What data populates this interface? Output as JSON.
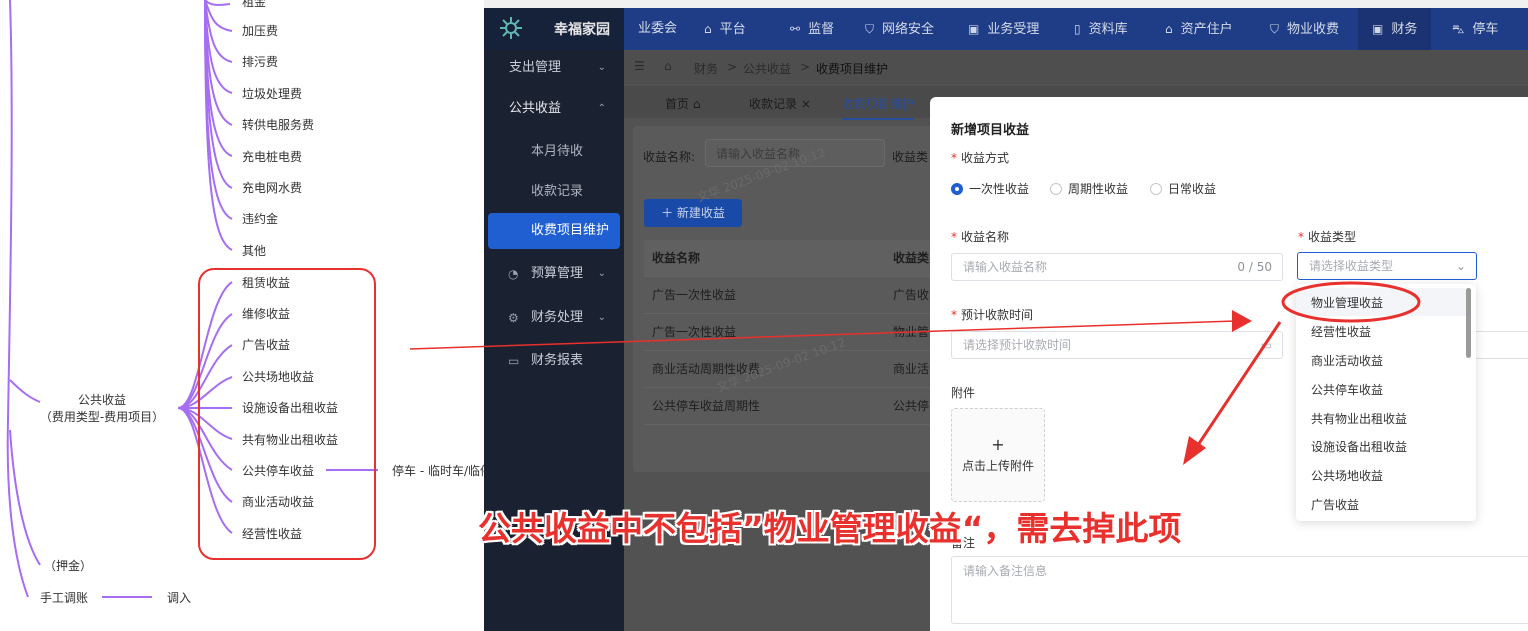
{
  "mindmap": {
    "top_items": [
      "租金",
      "加压费",
      "排污费",
      "垃圾处理费",
      "转供电服务费",
      "充电桩电费",
      "充电网水费",
      "违约金",
      "其他"
    ],
    "center_line1": "公共收益",
    "center_line2": "（费用类型-费用项目）",
    "boxed_items": [
      "租赁收益",
      "维修收益",
      "广告收益",
      "公共场地收益",
      "设施设备出租收益",
      "共有物业出租收益",
      "公共停车收益",
      "商业活动收益",
      "经营性收益"
    ],
    "parking_child": "停车 - 临时车/临停",
    "deposit": "（押金）",
    "manual_adjust": "手工调账",
    "transfer_in": "调入"
  },
  "app": {
    "logo_text": "幸福家园",
    "nav": [
      {
        "label": "业委会",
        "icon": ""
      },
      {
        "label": "平台",
        "icon": "⌂"
      },
      {
        "label": "监督",
        "icon": "⚯"
      },
      {
        "label": "网络安全",
        "icon": "⛉"
      },
      {
        "label": "业务受理",
        "icon": "▣"
      },
      {
        "label": "资料库",
        "icon": "▯"
      },
      {
        "label": "资产住户",
        "icon": "⌂"
      },
      {
        "label": "物业收费",
        "icon": "⛉"
      },
      {
        "label": "财务",
        "icon": "▣"
      },
      {
        "label": "停车",
        "icon": "⛍"
      }
    ],
    "sidebar": {
      "expense": "支出管理",
      "public_income": "公共收益",
      "this_month": "本月待收",
      "records": "收款记录",
      "item_maint": "收费项目维护",
      "budget": "预算管理",
      "finance_proc": "财务处理",
      "finance_report": "财务报表"
    },
    "breadcrumb": {
      "a": "财务",
      "b": "公共收益",
      "c": "收费项目维护",
      "sep": ">"
    },
    "tabs": {
      "home": "首页",
      "records": "收款记录",
      "maint": "收费项目维护"
    },
    "filter": {
      "name_label": "收益名称:",
      "name_placeholder": "请输入收益名称",
      "type_label": "收益类"
    },
    "new_button": "＋ 新建收益",
    "table": {
      "col1": "收益名称",
      "col2": "收益类",
      "rows": [
        {
          "name": "广告一次性收益",
          "type": "广告收"
        },
        {
          "name": "广告一次性收益",
          "type": "物业管"
        },
        {
          "name": "商业活动周期性收费",
          "type": "商业活"
        },
        {
          "name": "公共停车收益周期性",
          "type": "公共停"
        }
      ]
    },
    "watermark": "文华 2025-09-02 10:12"
  },
  "modal": {
    "title": "新增项目收益",
    "method_label": "收益方式",
    "methods": [
      "一次性收益",
      "周期性收益",
      "日常收益"
    ],
    "name_label": "收益名称",
    "name_placeholder": "请输入收益名称",
    "name_counter": "0 / 50",
    "type_label": "收益类型",
    "type_placeholder": "请选择收益类型",
    "date_label": "预计收款时间",
    "date_placeholder": "请选择预计收款时间",
    "attach_label": "附件",
    "upload_plus": "+",
    "upload_text": "点击上传附件",
    "remark_label": "备注",
    "remark_placeholder": "请输入备注信息"
  },
  "dropdown": {
    "options": [
      "物业管理收益",
      "经营性收益",
      "商业活动收益",
      "公共停车收益",
      "共有物业出租收益",
      "设施设备出租收益",
      "公共场地收益",
      "广告收益"
    ]
  },
  "annotation": {
    "text": "公共收益中不包括”物业管理收益“，需去掉此项"
  },
  "colors": {
    "accent": "#1f5fd1",
    "annotation_red": "#e8302c",
    "mindmap_purple": "#a66ef0",
    "topbar": "#1f3d87"
  }
}
